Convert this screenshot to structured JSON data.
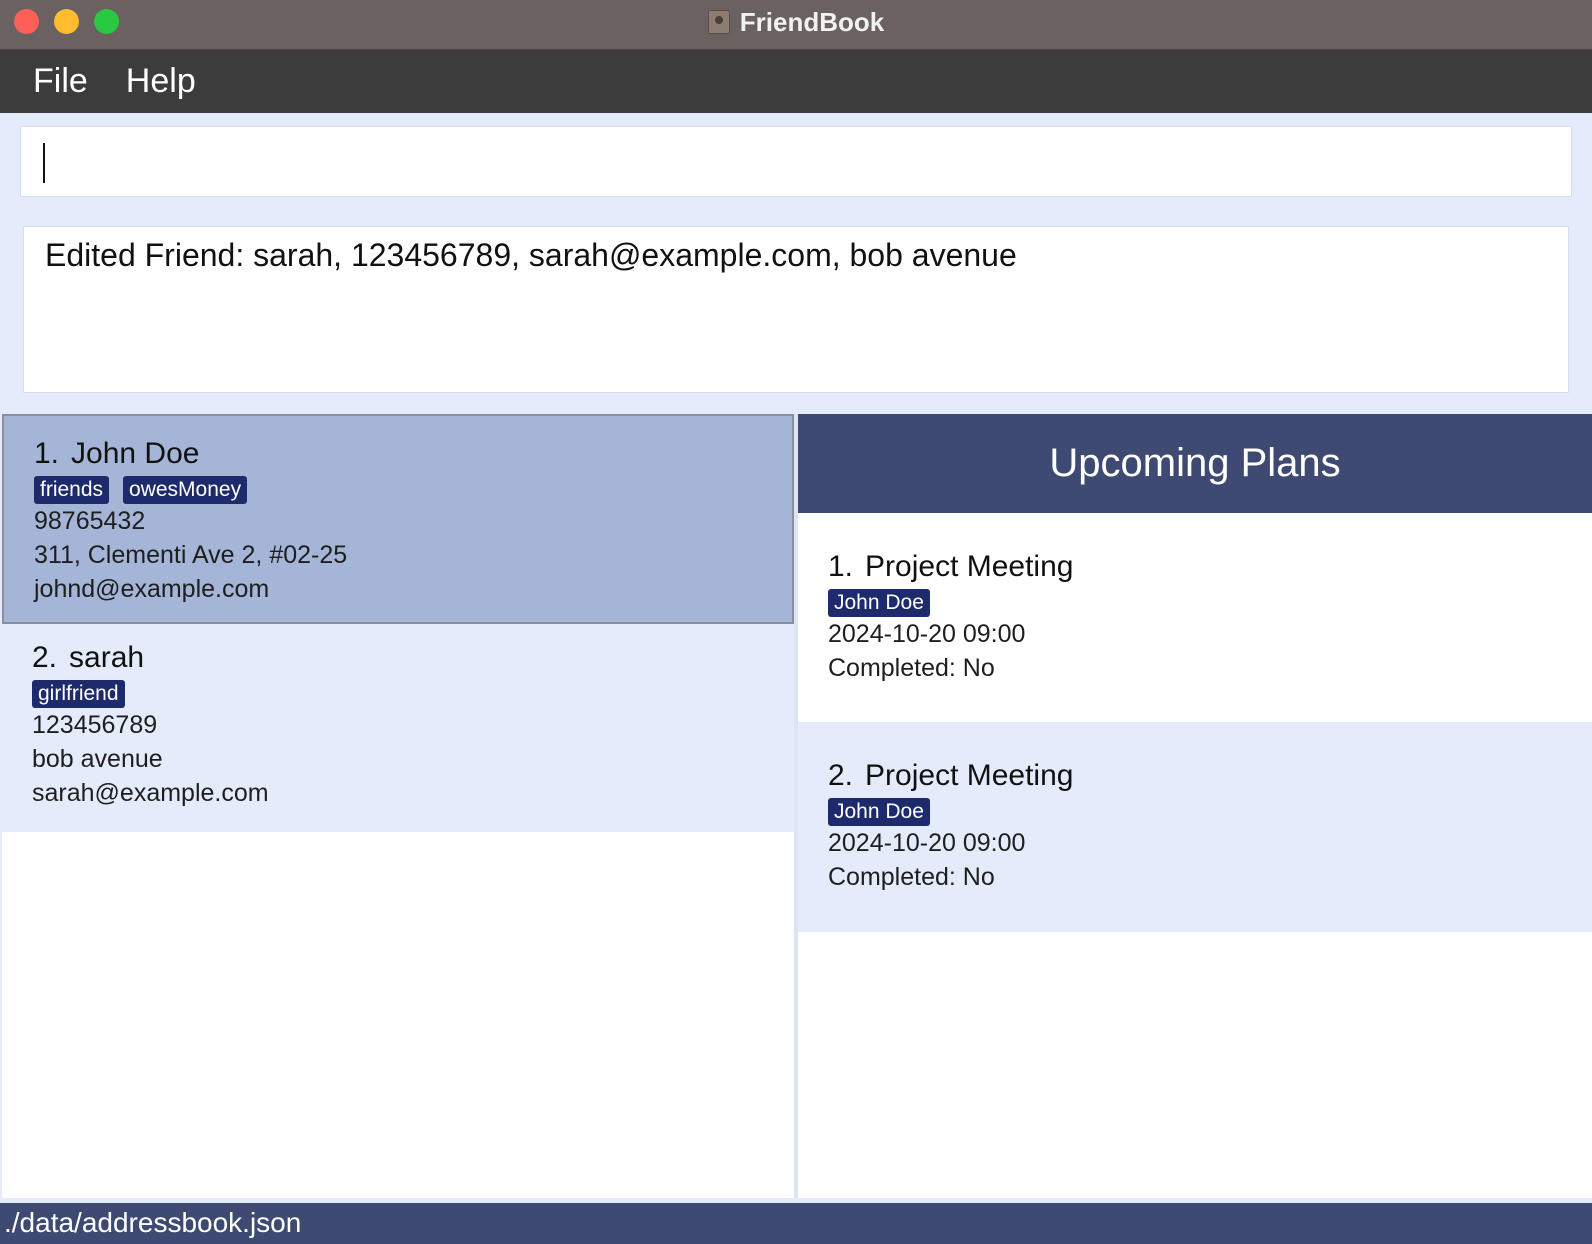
{
  "window": {
    "title": "FriendBook"
  },
  "menu": {
    "file": "File",
    "help": "Help"
  },
  "command": {
    "value": ""
  },
  "result": {
    "text": "Edited Friend: sarah, 123456789, sarah@example.com, bob avenue"
  },
  "friends": [
    {
      "index": "1.",
      "name": "John Doe",
      "tags": [
        "friends",
        "owesMoney"
      ],
      "phone": "98765432",
      "address": "311, Clementi Ave 2, #02-25",
      "email": "johnd@example.com"
    },
    {
      "index": "2.",
      "name": "sarah",
      "tags": [
        "girlfriend"
      ],
      "phone": "123456789",
      "address": "bob avenue",
      "email": "sarah@example.com"
    }
  ],
  "plans": {
    "title": "Upcoming Plans",
    "items": [
      {
        "index": "1.",
        "name": "Project Meeting",
        "person": "John Doe",
        "datetime": "2024-10-20 09:00",
        "completed": "Completed: No"
      },
      {
        "index": "2.",
        "name": "Project Meeting",
        "person": "John Doe",
        "datetime": "2024-10-20 09:00",
        "completed": "Completed: No"
      }
    ]
  },
  "status": {
    "path": "./data/addressbook.json"
  }
}
